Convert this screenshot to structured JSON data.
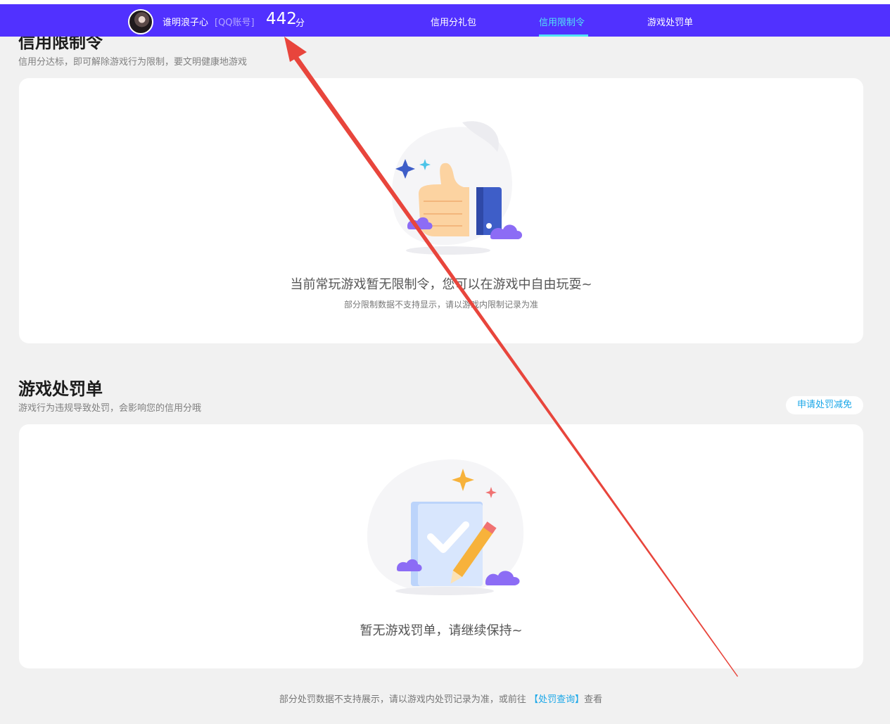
{
  "navbar": {
    "username": "谁明浪子心",
    "account_type": "[QQ账号]",
    "score_value": "442",
    "score_unit": "分",
    "links": [
      {
        "label": "信用分礼包",
        "active": false
      },
      {
        "label": "信用限制令",
        "active": true
      },
      {
        "label": "游戏处罚单",
        "active": false
      }
    ]
  },
  "restriction": {
    "title": "信用限制令",
    "subtitle": "信用分达标，即可解除游戏行为限制，要文明健康地游戏",
    "empty_message": "当前常玩游戏暂无限制令，您可以在游戏中自由玩耍~",
    "empty_note": "部分限制数据不支持显示，请以游戏内限制记录为准"
  },
  "penalty": {
    "title": "游戏处罚单",
    "subtitle": "游戏行为违规导致处罚，会影响您的信用分哦",
    "apply_button": "申请处罚减免",
    "empty_message": "暂无游戏罚单，请继续保持~"
  },
  "footer": {
    "text_before": "部分处罚数据不支持展示，请以游戏内处罚记录为准，或前往",
    "link": "【处罚查询】",
    "text_after": "查看"
  },
  "colors": {
    "nav_bg": "#5131ff",
    "nav_active": "#52e3f5",
    "link": "#1aa7e8",
    "page_bg": "#f1f1f1",
    "annotation_arrow": "#e8453c"
  }
}
